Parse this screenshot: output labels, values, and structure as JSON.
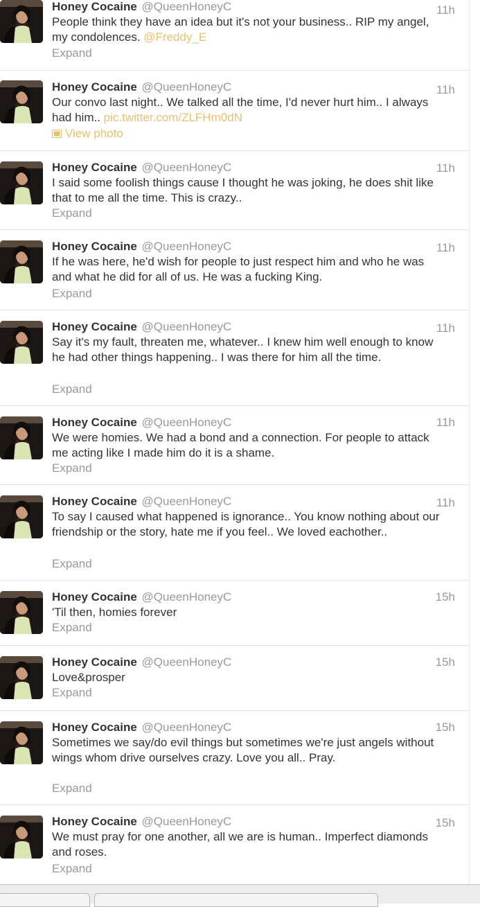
{
  "colors": {
    "name": "#333333",
    "muted": "#999999",
    "link": "#e8c070"
  },
  "tweets": [
    {
      "name": "Honey Cocaine",
      "handle": "@QueenHoneyC",
      "time": "11h",
      "text": "People think they have an idea but it's not your business.. RIP my angel, my condolences.",
      "link": "@Freddy_E",
      "action": "Expand"
    },
    {
      "name": "Honey Cocaine",
      "handle": "@QueenHoneyC",
      "time": "11h",
      "text": "Our convo last night.. We talked all the time, I'd never hurt him.. I always had him..",
      "link": "pic.twitter.com/ZLFHm0dN",
      "action": "View photo"
    },
    {
      "name": "Honey Cocaine",
      "handle": "@QueenHoneyC",
      "time": "11h",
      "text": "I said some foolish things cause I thought he was joking, he does shit like that to me all the time. This is crazy..",
      "action": "Expand"
    },
    {
      "name": "Honey Cocaine",
      "handle": "@QueenHoneyC",
      "time": "11h",
      "text": "If he was here, he'd wish for people to just respect him and who he was and what he did for all of us. He was a fucking King.",
      "action": "Expand"
    },
    {
      "name": "Honey Cocaine",
      "handle": "@QueenHoneyC",
      "time": "11h",
      "text": "Say it's my fault, threaten me, whatever.. I knew him well enough to know he had other things happening.. I was there for him all the time.",
      "action": "Expand"
    },
    {
      "name": "Honey Cocaine",
      "handle": "@QueenHoneyC",
      "time": "11h",
      "text": "We were homies. We had a bond and a connection. For people to attack me acting like I made him do it is a shame.",
      "action": "Expand"
    },
    {
      "name": "Honey Cocaine",
      "handle": "@QueenHoneyC",
      "time": "11h",
      "text": "To say I caused what happened is ignorance.. You know nothing about our friendship or the story, hate me if you feel.. We loved eachother..",
      "action": "Expand"
    },
    {
      "name": "Honey Cocaine",
      "handle": "@QueenHoneyC",
      "time": "15h",
      "text": "'Til then, homies forever",
      "action": "Expand"
    },
    {
      "name": "Honey Cocaine",
      "handle": "@QueenHoneyC",
      "time": "15h",
      "text": "Love&prosper",
      "action": "Expand"
    },
    {
      "name": "Honey Cocaine",
      "handle": "@QueenHoneyC",
      "time": "15h",
      "text": "Sometimes we say/do evil things but sometimes we're just angels without wings whom drive ourselves crazy. Love you all.. Pray.",
      "action": "Expand"
    },
    {
      "name": "Honey Cocaine",
      "handle": "@QueenHoneyC",
      "time": "15h",
      "text": "We must pray for one another, all we are is human.. Imperfect diamonds and roses.",
      "action": "Expand"
    }
  ]
}
